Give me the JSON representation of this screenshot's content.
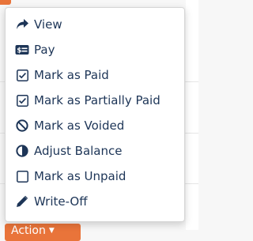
{
  "menu": {
    "items": [
      {
        "label": "View",
        "icon": "share-arrow-icon"
      },
      {
        "label": "Pay",
        "icon": "money-bill-icon"
      },
      {
        "label": "Mark as Paid",
        "icon": "checkbox-checked-icon"
      },
      {
        "label": "Mark as Partially Paid",
        "icon": "checkbox-checked-icon"
      },
      {
        "label": "Mark as Voided",
        "icon": "ban-icon"
      },
      {
        "label": "Adjust Balance",
        "icon": "half-circle-icon"
      },
      {
        "label": "Mark as Unpaid",
        "icon": "checkbox-empty-icon"
      },
      {
        "label": "Write-Off",
        "icon": "pencil-icon"
      }
    ]
  },
  "action_button": {
    "label": "Action",
    "caret": "▼"
  },
  "colors": {
    "menu_text": "#1d3557",
    "accent": "#e9743a"
  }
}
